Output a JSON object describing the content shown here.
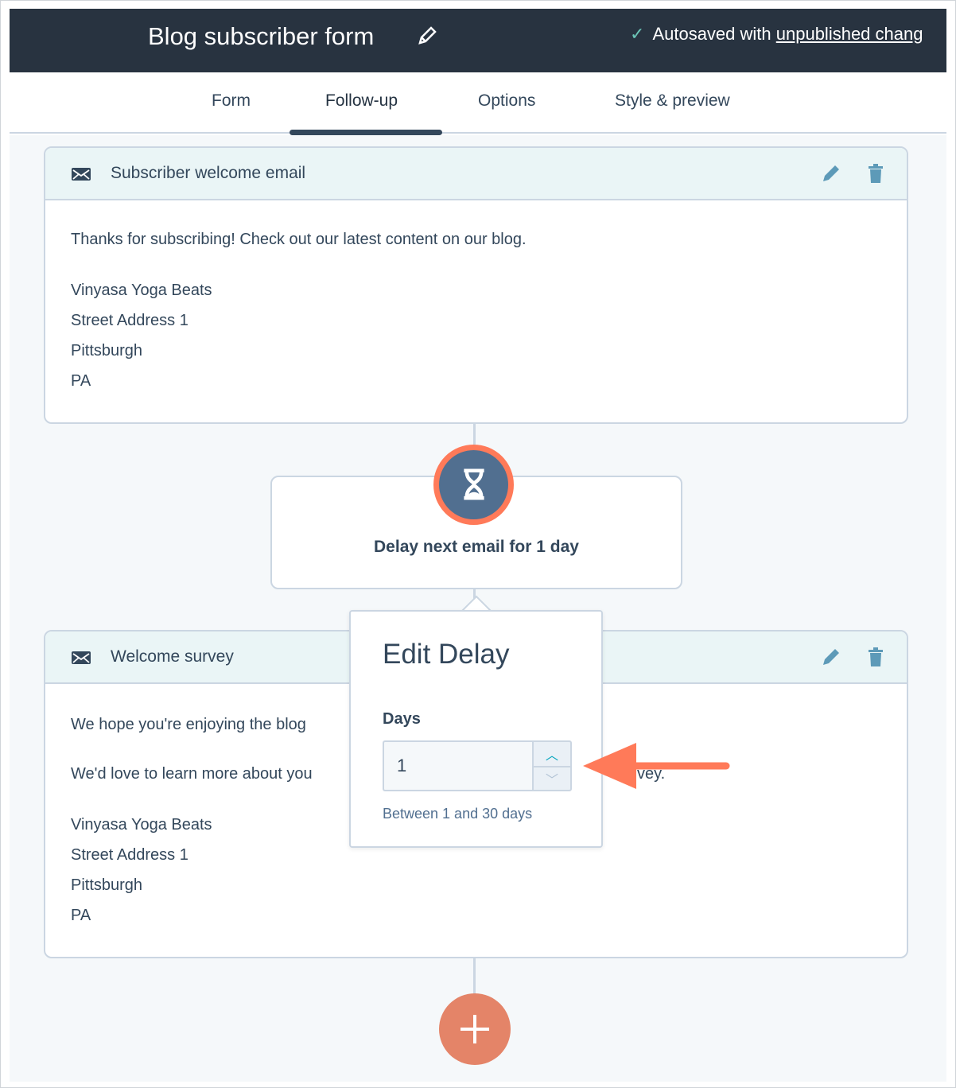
{
  "header": {
    "title": "Blog subscriber form",
    "autosave_prefix": "Autosaved with ",
    "autosave_link": "unpublished chang"
  },
  "tabs": [
    {
      "label": "Form"
    },
    {
      "label": "Follow-up",
      "active": true
    },
    {
      "label": "Options"
    },
    {
      "label": "Style & preview"
    }
  ],
  "cards": [
    {
      "title": "Subscriber welcome email",
      "lines": [
        "Thanks for subscribing! Check out our latest content on our blog.",
        "Vinyasa Yoga Beats",
        "Street Address 1",
        "Pittsburgh",
        "PA"
      ]
    },
    {
      "title": "Welcome survey",
      "lines": [
        "We hope you're enjoying the blog",
        "We'd love to learn more about you",
        "vey.",
        "Vinyasa Yoga Beats",
        "Street Address 1",
        "Pittsburgh",
        "PA"
      ]
    }
  ],
  "delay": {
    "text": "Delay next email for 1 day"
  },
  "popover": {
    "title": "Edit Delay",
    "days_label": "Days",
    "days_value": "1",
    "hint": "Between 1 and 30 days"
  },
  "colors": {
    "header": "#283340",
    "accent": "#ff7a59",
    "card_header": "#eaf5f6",
    "hourglass_bg": "#516f90"
  }
}
